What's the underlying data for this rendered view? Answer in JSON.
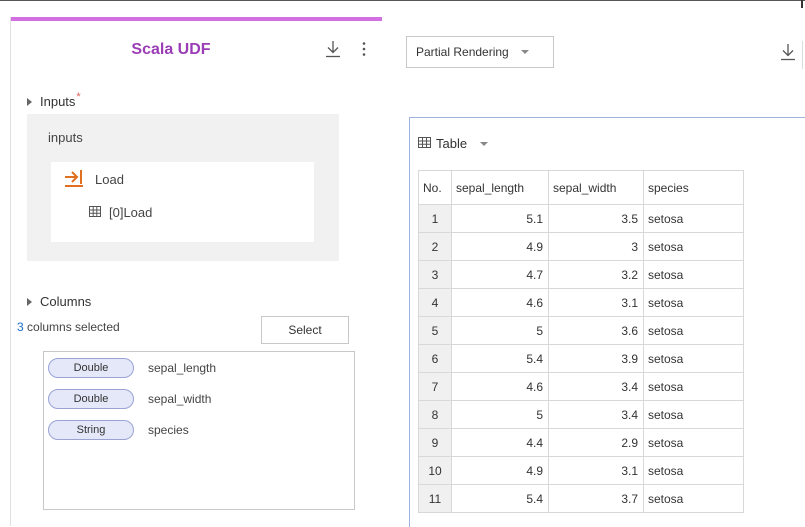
{
  "left_panel": {
    "title": "Scala UDF",
    "inputs_section": {
      "label": "Inputs",
      "required_mark": "*"
    },
    "inputs_box": {
      "title": "inputs",
      "load_label": "Load",
      "load_item_label": "[0]Load"
    },
    "columns_section": {
      "label": "Columns",
      "count": "3",
      "count_suffix": " columns selected",
      "select_label": "Select",
      "columns": [
        {
          "type": "Double",
          "name": "sepal_length"
        },
        {
          "type": "Double",
          "name": "sepal_width"
        },
        {
          "type": "String",
          "name": "species"
        }
      ]
    }
  },
  "right_panel": {
    "render_mode": "Partial Rendering",
    "view_label": "Table",
    "table": {
      "headers": [
        "No.",
        "sepal_length",
        "sepal_width",
        "species"
      ],
      "rows": [
        [
          "1",
          "5.1",
          "3.5",
          "setosa"
        ],
        [
          "2",
          "4.9",
          "3",
          "setosa"
        ],
        [
          "3",
          "4.7",
          "3.2",
          "setosa"
        ],
        [
          "4",
          "4.6",
          "3.1",
          "setosa"
        ],
        [
          "5",
          "5",
          "3.6",
          "setosa"
        ],
        [
          "6",
          "5.4",
          "3.9",
          "setosa"
        ],
        [
          "7",
          "4.6",
          "3.4",
          "setosa"
        ],
        [
          "8",
          "5",
          "3.4",
          "setosa"
        ],
        [
          "9",
          "4.4",
          "2.9",
          "setosa"
        ],
        [
          "10",
          "4.9",
          "3.1",
          "setosa"
        ],
        [
          "11",
          "5.4",
          "3.7",
          "setosa"
        ]
      ]
    }
  },
  "colors": {
    "accent": "#d26fe3",
    "title": "#9b3db5",
    "load_icon": "#e07020",
    "link": "#1e6ec8",
    "pill_border": "#9aa3d4",
    "pill_fill": "#e4e8f8"
  },
  "icons": {
    "download": "download-icon",
    "more": "more-vertical-icon",
    "load": "arrow-into-box-icon",
    "table": "table-grid-icon"
  }
}
